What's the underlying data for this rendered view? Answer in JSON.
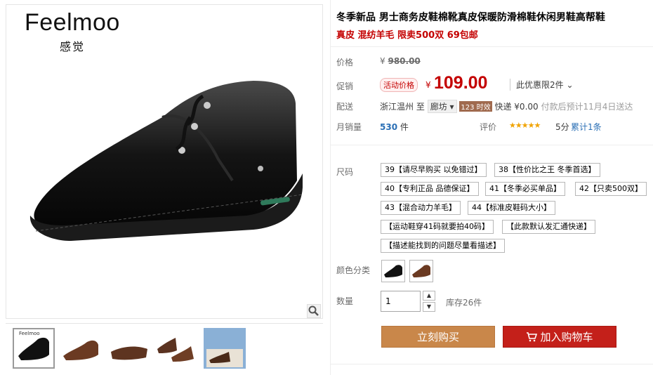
{
  "brand": {
    "name": "Feelmoo",
    "sub": "感觉"
  },
  "thumb_brand": "Feelmoo",
  "product": {
    "title": "冬季新品 男士商务皮鞋棉靴真皮保暖防滑棉鞋休闲男鞋高帮鞋",
    "subtitle": "真皮 混纺羊毛 限卖500双 69包邮"
  },
  "price": {
    "label": "价格",
    "orig_currency": "¥",
    "orig": "980.00",
    "promo_label": "促销",
    "badge": "活动价格",
    "currency": "¥",
    "value": "109.00",
    "promo_note": "此优惠限2件"
  },
  "shipping": {
    "label": "配送",
    "from": "浙江温州",
    "to_word": "至",
    "to_city": "廊坊",
    "time_tag": "123 时效",
    "express": "快递 ¥0.00",
    "note": "付款后预计11月4日送达"
  },
  "sales": {
    "label": "月销量",
    "count": "530",
    "unit": "件"
  },
  "review": {
    "label": "评价",
    "stars": "★★★★★",
    "score": "5分",
    "link": "累计1条"
  },
  "sizes": {
    "label": "尺码",
    "options": [
      "39【请尽早购买 以免错过】",
      "38【性价比之王 冬季首选】",
      "40【专利正品 品德保证】",
      "41【冬季必买单品】",
      "42【只卖500双】",
      "43【混合动力羊毛】",
      "44【标准皮鞋码大小】",
      "【运动鞋穿41码就要拍40码】",
      "【此款默认发汇通快递】",
      "【描述能找到的问题尽量看描述】"
    ]
  },
  "colors": {
    "label": "颜色分类",
    "options": [
      "black-boot",
      "brown-boot"
    ]
  },
  "quantity": {
    "label": "数量",
    "value": "1",
    "stock": "库存26件"
  },
  "actions": {
    "buy": "立刻购买",
    "cart": "加入购物车"
  },
  "icons": {
    "zoom": "magnifier-icon",
    "cart": "cart-icon"
  }
}
